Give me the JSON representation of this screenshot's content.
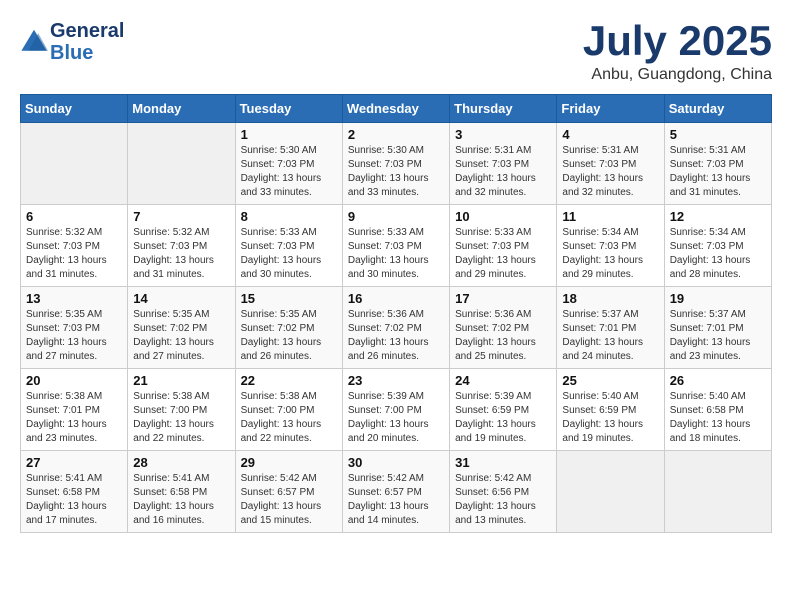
{
  "header": {
    "logo_line1": "General",
    "logo_line2": "Blue",
    "month": "July 2025",
    "location": "Anbu, Guangdong, China"
  },
  "weekdays": [
    "Sunday",
    "Monday",
    "Tuesday",
    "Wednesday",
    "Thursday",
    "Friday",
    "Saturday"
  ],
  "weeks": [
    [
      {
        "day": "",
        "info": ""
      },
      {
        "day": "",
        "info": ""
      },
      {
        "day": "1",
        "info": "Sunrise: 5:30 AM\nSunset: 7:03 PM\nDaylight: 13 hours\nand 33 minutes."
      },
      {
        "day": "2",
        "info": "Sunrise: 5:30 AM\nSunset: 7:03 PM\nDaylight: 13 hours\nand 33 minutes."
      },
      {
        "day": "3",
        "info": "Sunrise: 5:31 AM\nSunset: 7:03 PM\nDaylight: 13 hours\nand 32 minutes."
      },
      {
        "day": "4",
        "info": "Sunrise: 5:31 AM\nSunset: 7:03 PM\nDaylight: 13 hours\nand 32 minutes."
      },
      {
        "day": "5",
        "info": "Sunrise: 5:31 AM\nSunset: 7:03 PM\nDaylight: 13 hours\nand 31 minutes."
      }
    ],
    [
      {
        "day": "6",
        "info": "Sunrise: 5:32 AM\nSunset: 7:03 PM\nDaylight: 13 hours\nand 31 minutes."
      },
      {
        "day": "7",
        "info": "Sunrise: 5:32 AM\nSunset: 7:03 PM\nDaylight: 13 hours\nand 31 minutes."
      },
      {
        "day": "8",
        "info": "Sunrise: 5:33 AM\nSunset: 7:03 PM\nDaylight: 13 hours\nand 30 minutes."
      },
      {
        "day": "9",
        "info": "Sunrise: 5:33 AM\nSunset: 7:03 PM\nDaylight: 13 hours\nand 30 minutes."
      },
      {
        "day": "10",
        "info": "Sunrise: 5:33 AM\nSunset: 7:03 PM\nDaylight: 13 hours\nand 29 minutes."
      },
      {
        "day": "11",
        "info": "Sunrise: 5:34 AM\nSunset: 7:03 PM\nDaylight: 13 hours\nand 29 minutes."
      },
      {
        "day": "12",
        "info": "Sunrise: 5:34 AM\nSunset: 7:03 PM\nDaylight: 13 hours\nand 28 minutes."
      }
    ],
    [
      {
        "day": "13",
        "info": "Sunrise: 5:35 AM\nSunset: 7:03 PM\nDaylight: 13 hours\nand 27 minutes."
      },
      {
        "day": "14",
        "info": "Sunrise: 5:35 AM\nSunset: 7:02 PM\nDaylight: 13 hours\nand 27 minutes."
      },
      {
        "day": "15",
        "info": "Sunrise: 5:35 AM\nSunset: 7:02 PM\nDaylight: 13 hours\nand 26 minutes."
      },
      {
        "day": "16",
        "info": "Sunrise: 5:36 AM\nSunset: 7:02 PM\nDaylight: 13 hours\nand 26 minutes."
      },
      {
        "day": "17",
        "info": "Sunrise: 5:36 AM\nSunset: 7:02 PM\nDaylight: 13 hours\nand 25 minutes."
      },
      {
        "day": "18",
        "info": "Sunrise: 5:37 AM\nSunset: 7:01 PM\nDaylight: 13 hours\nand 24 minutes."
      },
      {
        "day": "19",
        "info": "Sunrise: 5:37 AM\nSunset: 7:01 PM\nDaylight: 13 hours\nand 23 minutes."
      }
    ],
    [
      {
        "day": "20",
        "info": "Sunrise: 5:38 AM\nSunset: 7:01 PM\nDaylight: 13 hours\nand 23 minutes."
      },
      {
        "day": "21",
        "info": "Sunrise: 5:38 AM\nSunset: 7:00 PM\nDaylight: 13 hours\nand 22 minutes."
      },
      {
        "day": "22",
        "info": "Sunrise: 5:38 AM\nSunset: 7:00 PM\nDaylight: 13 hours\nand 22 minutes."
      },
      {
        "day": "23",
        "info": "Sunrise: 5:39 AM\nSunset: 7:00 PM\nDaylight: 13 hours\nand 20 minutes."
      },
      {
        "day": "24",
        "info": "Sunrise: 5:39 AM\nSunset: 6:59 PM\nDaylight: 13 hours\nand 19 minutes."
      },
      {
        "day": "25",
        "info": "Sunrise: 5:40 AM\nSunset: 6:59 PM\nDaylight: 13 hours\nand 19 minutes."
      },
      {
        "day": "26",
        "info": "Sunrise: 5:40 AM\nSunset: 6:58 PM\nDaylight: 13 hours\nand 18 minutes."
      }
    ],
    [
      {
        "day": "27",
        "info": "Sunrise: 5:41 AM\nSunset: 6:58 PM\nDaylight: 13 hours\nand 17 minutes."
      },
      {
        "day": "28",
        "info": "Sunrise: 5:41 AM\nSunset: 6:58 PM\nDaylight: 13 hours\nand 16 minutes."
      },
      {
        "day": "29",
        "info": "Sunrise: 5:42 AM\nSunset: 6:57 PM\nDaylight: 13 hours\nand 15 minutes."
      },
      {
        "day": "30",
        "info": "Sunrise: 5:42 AM\nSunset: 6:57 PM\nDaylight: 13 hours\nand 14 minutes."
      },
      {
        "day": "31",
        "info": "Sunrise: 5:42 AM\nSunset: 6:56 PM\nDaylight: 13 hours\nand 13 minutes."
      },
      {
        "day": "",
        "info": ""
      },
      {
        "day": "",
        "info": ""
      }
    ]
  ]
}
